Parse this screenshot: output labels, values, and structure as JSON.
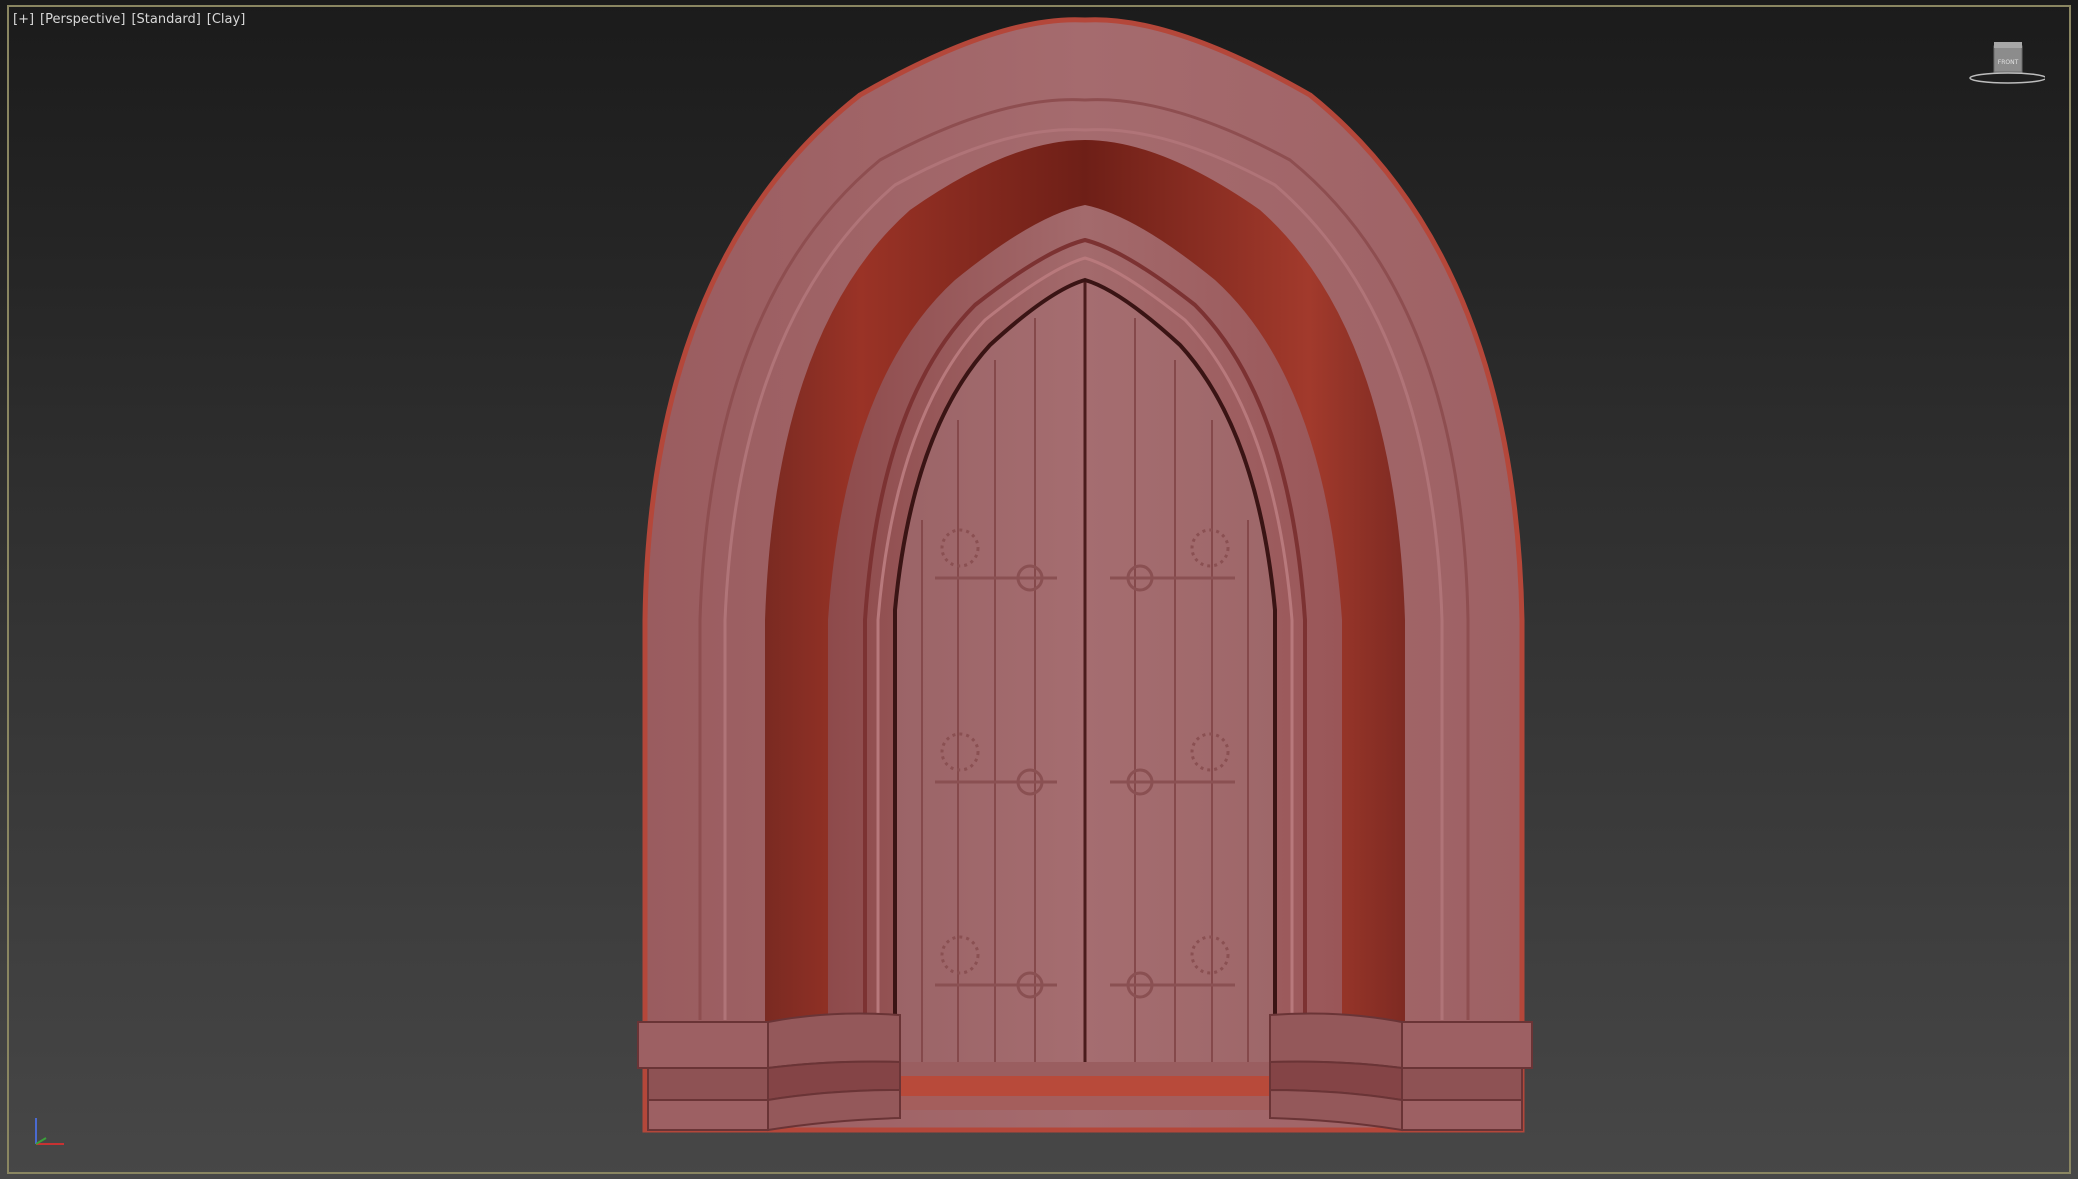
{
  "viewport": {
    "labels": {
      "plus": "[+]",
      "view": "[Perspective]",
      "shading_preset": "[Standard]",
      "shading_mode": "[Clay]"
    },
    "viewcube_face": "FRONT",
    "frame_color": "#8a8661",
    "active": true
  },
  "scene": {
    "object": "gothic-arch-doorway",
    "clay_color": "#a0686b",
    "deep_color": "#8a2a1e"
  },
  "axis_tripod": {
    "axes": [
      "x",
      "y",
      "z"
    ],
    "colors": {
      "x": "#c83232",
      "y": "#3aa03a",
      "z": "#4a6ad0"
    }
  }
}
